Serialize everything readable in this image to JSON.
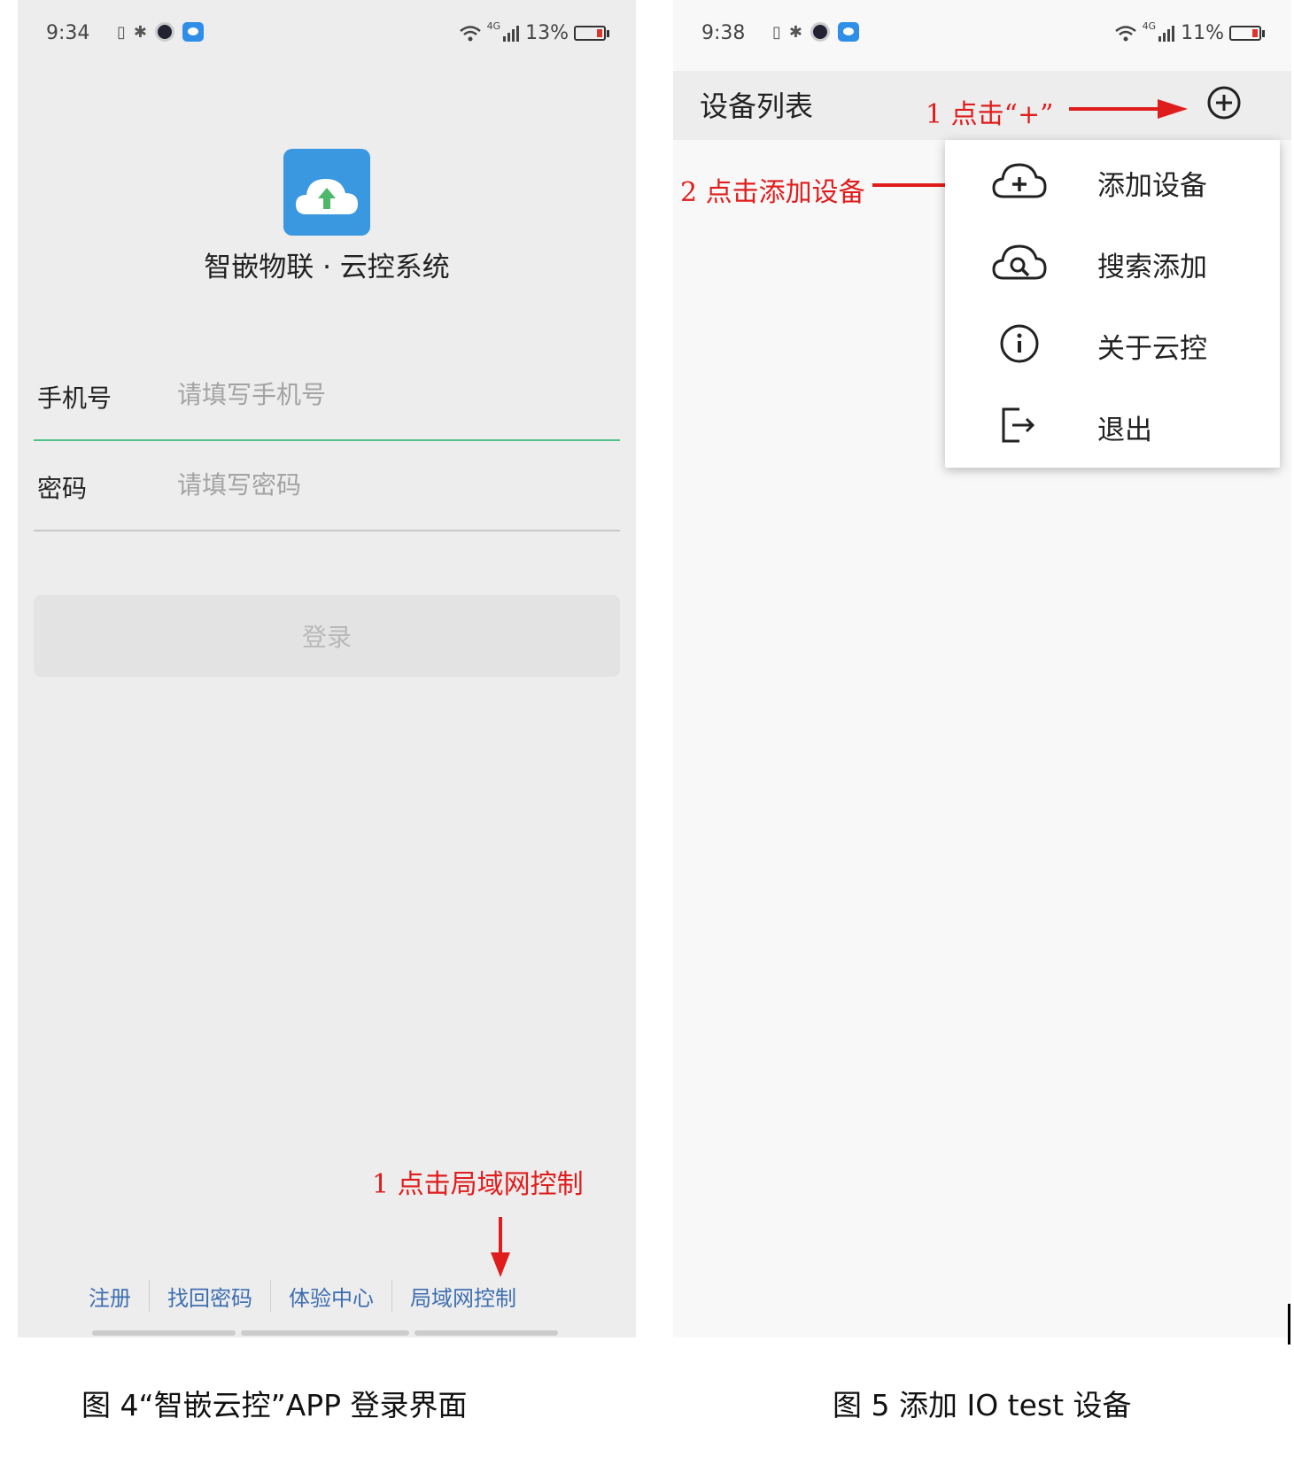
{
  "left_screen": {
    "status": {
      "time": "9:34",
      "network": "4G",
      "battery": "13%"
    },
    "app_name": "智嵌物联 · 云控系统",
    "phone_label": "手机号",
    "phone_placeholder": "请填写手机号",
    "password_label": "密码",
    "password_placeholder": "请填写密码",
    "login_button": "登录",
    "links": [
      "注册",
      "找回密码",
      "体验中心",
      "局域网控制"
    ]
  },
  "right_screen": {
    "status": {
      "time": "9:38",
      "network": "4G",
      "battery": "11%"
    },
    "title": "设备列表",
    "menu": [
      {
        "label": "添加设备",
        "icon": "cloud-add-icon"
      },
      {
        "label": "搜索添加",
        "icon": "cloud-search-icon"
      },
      {
        "label": "关于云控",
        "icon": "info-icon"
      },
      {
        "label": "退出",
        "icon": "logout-icon"
      }
    ]
  },
  "annotations": {
    "left_step1": "1  点击局域网控制",
    "right_step1": "1  点击“+”",
    "right_step2": "2  点击添加设备"
  },
  "captions": {
    "fig4": "图 4“智嵌云控”APP 登录界面",
    "fig5": "图 5 添加 IO test 设备"
  },
  "colors": {
    "accent_green": "#4fc28c",
    "link_blue": "#3e6fb1",
    "annotation_red": "#e01d1d",
    "logo_blue": "#3a98e0"
  }
}
